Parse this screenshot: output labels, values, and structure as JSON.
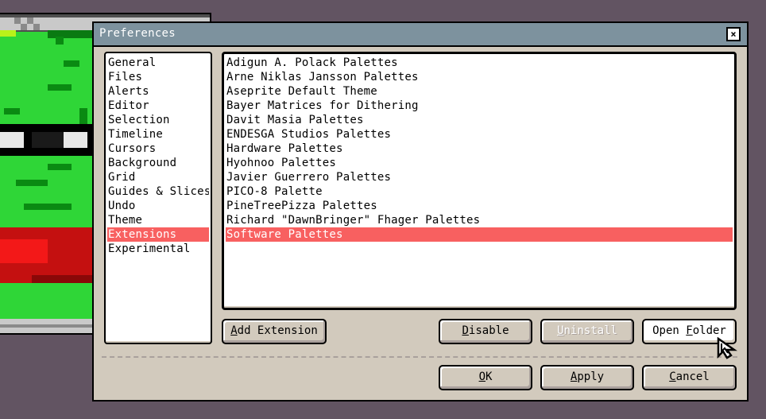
{
  "dialog": {
    "title": "Preferences",
    "close_label": "×"
  },
  "categories": [
    {
      "label": "General"
    },
    {
      "label": "Files"
    },
    {
      "label": "Alerts"
    },
    {
      "label": "Editor"
    },
    {
      "label": "Selection"
    },
    {
      "label": "Timeline"
    },
    {
      "label": "Cursors"
    },
    {
      "label": "Background"
    },
    {
      "label": "Grid"
    },
    {
      "label": "Guides & Slices"
    },
    {
      "label": "Undo"
    },
    {
      "label": "Theme"
    },
    {
      "label": "Extensions",
      "selected": true
    },
    {
      "label": "Experimental"
    }
  ],
  "extensions": [
    {
      "label": "Adigun A. Polack Palettes"
    },
    {
      "label": "Arne Niklas Jansson Palettes"
    },
    {
      "label": "Aseprite Default Theme"
    },
    {
      "label": "Bayer Matrices for Dithering"
    },
    {
      "label": "Davit Masia Palettes"
    },
    {
      "label": "ENDESGA Studios Palettes"
    },
    {
      "label": "Hardware Palettes"
    },
    {
      "label": "Hyohnoo Palettes"
    },
    {
      "label": "Javier Guerrero Palettes"
    },
    {
      "label": "PICO-8 Palette"
    },
    {
      "label": "PineTreePizza Palettes"
    },
    {
      "label": "Richard \"DawnBringer\" Fhager Palettes"
    },
    {
      "label": "Software Palettes",
      "selected": true
    }
  ],
  "buttons": {
    "add_extension": {
      "mnemonic": "A",
      "rest": "dd Extension"
    },
    "disable": {
      "mnemonic": "D",
      "rest": "isable"
    },
    "uninstall": {
      "mnemonic": "U",
      "rest": "ninstall"
    },
    "open_folder": {
      "pre": "Open ",
      "mnemonic": "F",
      "rest": "older"
    },
    "ok": {
      "mnemonic": "O",
      "rest": "K"
    },
    "apply": {
      "mnemonic": "A",
      "rest": "pply"
    },
    "cancel": {
      "mnemonic": "C",
      "rest": "ancel"
    }
  },
  "colors": {
    "background": "#625462",
    "dialog_face": "#d2cabd",
    "titlebar": "#7d929e",
    "selection": "#f86060",
    "sprite_green": "#2fd637"
  },
  "icons": {
    "close": "close-icon",
    "cursor": "mouse-pointer-icon"
  }
}
